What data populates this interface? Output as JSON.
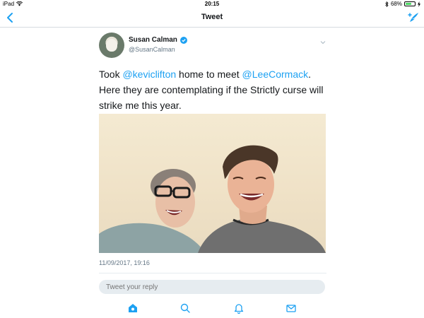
{
  "status_bar": {
    "device": "iPad",
    "time": "20:15",
    "battery_percent": "68%",
    "battery_level": 0.68
  },
  "nav": {
    "title": "Tweet",
    "back_icon": "chevron-left-icon",
    "compose_icon": "compose-tweet-icon"
  },
  "tweet": {
    "author": {
      "display_name": "Susan Calman",
      "handle": "@SusanCalman",
      "verified": true
    },
    "text_parts": {
      "p1": "Took ",
      "mention1": "@keviclifton",
      "p2": " home to meet ",
      "mention2": "@LeeCormack",
      "p3": ". Here they are contemplating if the Strictly curse will strike me this year."
    },
    "timestamp": "11/09/2017, 19:16"
  },
  "reply": {
    "placeholder": "Tweet your reply"
  },
  "tab_bar": {
    "items": [
      {
        "icon": "home-icon",
        "active": true
      },
      {
        "icon": "search-icon",
        "active": false
      },
      {
        "icon": "notifications-icon",
        "active": false
      },
      {
        "icon": "messages-icon",
        "active": false
      }
    ]
  },
  "colors": {
    "accent": "#1da1f2",
    "secondary_text": "#657786"
  }
}
